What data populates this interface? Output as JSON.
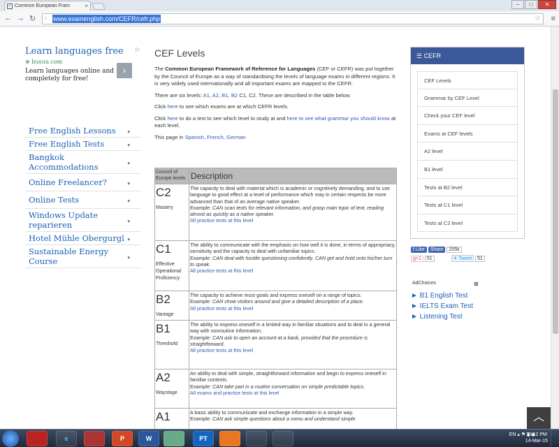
{
  "browser": {
    "tab_title": "Common European Fram",
    "url": "www.examenglish.com/CEFR/cefr.php"
  },
  "left_ad": {
    "title": "Learn languages free",
    "source": "busuu.com",
    "description": "Learn languages online and completely for free!",
    "arrow": "›"
  },
  "left_links": [
    "Free English Lessons",
    "Free English Tests",
    "Bangkok Accommodations",
    "Online Freelancer?",
    "Online Tests",
    "Windows Update reparieren",
    "Hotel Mühle Obergurgl",
    "Sustainable Energy Course"
  ],
  "main": {
    "title": "CEF Levels",
    "intro_prefix": "The ",
    "intro_bold": "Common European Framework of Reference for Languages",
    "intro_rest": " (CEF or CEFR) was put together by the Council of Europe as a way of standardising the levels of language exams in different regions. It is very widely used internationally and all important exams are mapped to the CEFR.",
    "levels_prefix": "There are six levels: ",
    "levels_links": [
      "A1",
      "A2",
      "B1",
      "B2"
    ],
    "levels_suffix": " C1, C2. These are described in the table below.",
    "click1_prefix": "Click ",
    "click1_link": "here",
    "click1_suffix": " to see which exams are at which CEFR levels.",
    "click2_prefix": "Click ",
    "click2_link": "here",
    "click2_mid": " to do a test to see which level to study at and ",
    "click2_link2": "here to see what grammar you should know",
    "click2_suffix": " at each level.",
    "langs_prefix": "This page in ",
    "lang1": "Spanish",
    "lang_sep1": ", ",
    "lang2": "French",
    "lang_sep2": ", ",
    "lang3": "German"
  },
  "table": {
    "header_level": "Council of Europe levels",
    "header_desc": "Description",
    "rows": [
      {
        "code": "C2",
        "name": "Mastery",
        "desc": "The capacity to deal with material which is academic or cognitively demanding, and to use language to good effect at a level of performance which may in certain respects be more advanced than that of an average native speaker.",
        "example_label": "Example: ",
        "example": "CAN scan texts for relevant information, and grasp main topic of text, reading almost as quickly as a native speaker.",
        "link": "All practice tests at this level"
      },
      {
        "code": "C1",
        "name": "Effective Operational Proficiency",
        "desc": "The ability to communicate with the emphasis on how well it is done, in terms of appropriacy, sensitivity and the capacity to deal with unfamiliar topics.",
        "example_label": "Example: ",
        "example": "CAN deal with hostile questioning confidently. CAN get and hold onto his/her turn to speak.",
        "link": "All practice tests at this level"
      },
      {
        "code": "B2",
        "name": "Vantage",
        "desc": "The capacity to achieve most goals and express oneself on a range of topics.",
        "example_label": "Example: ",
        "example": "CAN show visitors around and give a detailed description of a place.",
        "link": "All practice tests at this level"
      },
      {
        "code": "B1",
        "name": "Threshold",
        "desc": "The ability to express oneself in a limited way in familiar situations and to deal in a general way with nonroutine information.",
        "example_label": "Example: ",
        "example": "CAN ask to open an account at a bank, provided that the procedure is straightforward.",
        "link": "All practice tests at this level"
      },
      {
        "code": "A2",
        "name": "Waystage",
        "desc": "An ability to deal with simple, straightforward information and begin to express oneself in familiar contexts.",
        "example_label": "Example: ",
        "example": "CAN take part in a routine conversation on simple predictable topics.",
        "link": "All exams and practice tests at this level"
      },
      {
        "code": "A1",
        "name": "",
        "desc": "A basic ability to communicate and exchange information in a simple way.",
        "example_label": "Example: ",
        "example": "CAN ask simple questions about a menu and understand simple",
        "link": ""
      }
    ]
  },
  "sidebar": {
    "title": "CEFR",
    "items": [
      "CEF Levels",
      "Grammar by CEF Level",
      "Check your CEF level",
      "Exams at CEF levels",
      "A2 level",
      "B1 level",
      "Tests at B2 level",
      "Tests at C1 level",
      "Tests at C2 level"
    ]
  },
  "social": {
    "like": "Like",
    "share": "Share",
    "share_count": "205k",
    "gplus": "g+1",
    "gplus_count": "51",
    "tweet": "Tweet",
    "tweet_count": "51"
  },
  "right_ads": {
    "adchoices": "AdChoices",
    "links": [
      "► B1 English Test",
      "► IELTS Exam Test",
      "► Listening Test"
    ]
  },
  "taskbar": {
    "lang": "EN",
    "time": "10:12 PM",
    "date": "14-Mar-15",
    "apps": [
      "",
      "e",
      "",
      "P",
      "W",
      "",
      "PT",
      "",
      "",
      ""
    ]
  }
}
